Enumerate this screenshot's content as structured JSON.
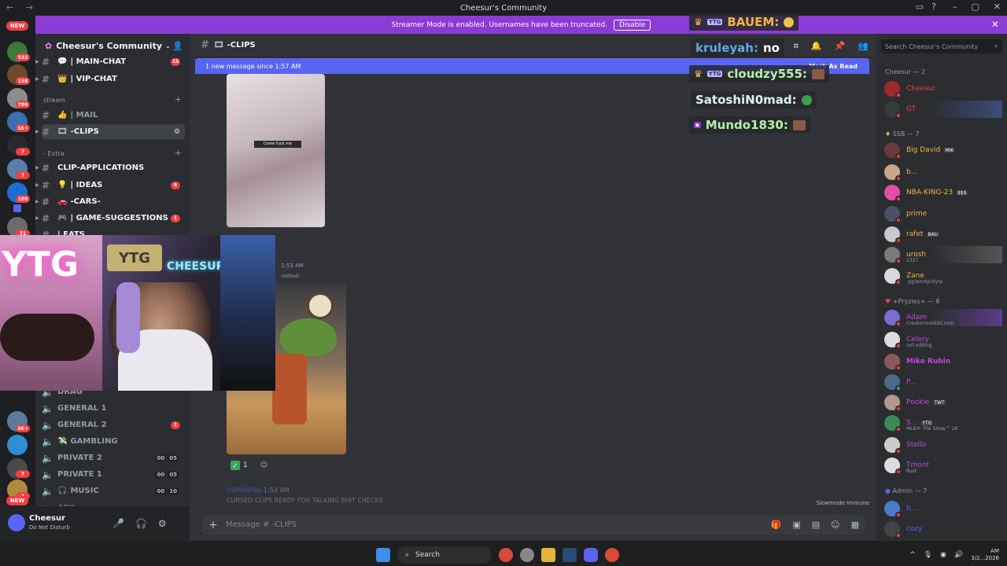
{
  "window": {
    "title": "Cheesur's Community"
  },
  "banner": {
    "text": "Streamer Mode is enabled. Usernames have been truncated.",
    "disable_label": "Disable"
  },
  "rail": {
    "badges": [
      "NEW",
      "532",
      "158",
      "786",
      "1K+",
      "7",
      "7",
      "188",
      "71",
      "3K+",
      "7",
      "2",
      "NEW",
      "759"
    ]
  },
  "server": {
    "name": "Cheesur's Community"
  },
  "channels": [
    {
      "label": "| MAIN-CHAT",
      "badge": "15"
    },
    {
      "label": "| VIP-CHAT"
    },
    {
      "label": "| MAIL"
    },
    {
      "label": "-CLIPS"
    },
    {
      "label": "CLIP-APPLICATIONS"
    },
    {
      "label": "| IDEAS",
      "badge": "6"
    },
    {
      "label": "-CARS-"
    },
    {
      "label": "| GAME-SUGGESTIONS",
      "badge": "1"
    },
    {
      "label": "| EATS"
    }
  ],
  "categories": {
    "stream": "stream",
    "extra": "- Extra"
  },
  "voice": [
    {
      "label": "DRAG"
    },
    {
      "label": "GENERAL 1"
    },
    {
      "label": "GENERAL 2",
      "badge": "1"
    },
    {
      "label": "GAMBLING"
    },
    {
      "label": "PRIVATE 2",
      "c1": "00",
      "c2": "05"
    },
    {
      "label": "PRIVATE 1",
      "c1": "00",
      "c2": "05"
    },
    {
      "label": "MUSIC",
      "c1": "00",
      "c2": "10"
    },
    {
      "label": "AFK"
    }
  ],
  "user": {
    "name": "Cheesur",
    "status": "Do Not Disturb"
  },
  "chat": {
    "channel": "-CLIPS",
    "new_message_bar": "1 new message since 1:57 AM",
    "mark_read": "Mark As Read",
    "time1": "1:53 AM",
    "edited": "(edited)",
    "reaction_count": "1",
    "faded_author": "OSMANPep",
    "faded_time": "1:53 AM",
    "faded_text": "CURSED CLIPS READY FOR TALKING SHIT CHECKS",
    "slowmode": "Slowmode Immune",
    "input_placeholder": "Message #  -CLIPS",
    "image1_caption": "Come fuck me"
  },
  "stream_chat": [
    {
      "name": "BAUEM:",
      "msg": "",
      "color": "#f6b63d"
    },
    {
      "name": "kruleyah:",
      "msg": "no",
      "color": "#5ea9e5"
    },
    {
      "name": "cloudzy555:",
      "msg": "",
      "color": "#b2f3a3"
    },
    {
      "name": "SatoshiN0mad:",
      "msg": "",
      "color": "#d8f2f5"
    },
    {
      "name": "Mundo1830:",
      "msg": "",
      "color": "#b2f3a3"
    }
  ],
  "webcam": {
    "sign": "YTG",
    "neon": "YTG",
    "neon2": "CHEESUR"
  },
  "members": {
    "search_placeholder": "Search Cheesur's Community",
    "groups": [
      {
        "title": "Cheesur — 2"
      },
      {
        "title": "SSB — 7"
      },
      {
        "title": "+Pryzies+ — 8"
      },
      {
        "title": "Admin — 7"
      }
    ],
    "list": [
      {
        "name": "Cheesur",
        "color": "#f23f43"
      },
      {
        "name": "GT",
        "color": "#f23f43"
      },
      {
        "name": "Big David",
        "color": "#f6b63d",
        "tag": "MIK"
      },
      {
        "name": "b...",
        "color": "#f6b63d"
      },
      {
        "name": "NBA-KING-23",
        "color": "#f6b63d",
        "tag": "$$$"
      },
      {
        "name": "prime",
        "color": "#f6b63d"
      },
      {
        "name": "rafet",
        "color": "#f6b63d",
        "tag": "BAU"
      },
      {
        "name": "urosh",
        "color": "#f6b63d",
        "sub": "1337"
      },
      {
        "name": "Zane",
        "color": "#f6b63d",
        "sub": ".gg/windycityrp"
      },
      {
        "name": "Adam",
        "color": "#c048d9",
        "sub": "Creatortoolslist.com"
      },
      {
        "name": "Celery",
        "color": "#c048d9",
        "sub": "not editing"
      },
      {
        "name": "Mike Rubin",
        "color": "#c048d9"
      },
      {
        "name": "P...",
        "color": "#c048d9"
      },
      {
        "name": "Pookie",
        "color": "#c048d9",
        "tag": "TWT"
      },
      {
        "name": "S...",
        "color": "#c048d9",
        "tag": "YTG",
        "sub": "MLB® The Show™ 26"
      },
      {
        "name": "Stello",
        "color": "#c048d9"
      },
      {
        "name": "Tmont",
        "color": "#c048d9",
        "sub": "Rust"
      },
      {
        "name": "b...",
        "color": "#5865f2"
      },
      {
        "name": "cozy",
        "color": "#5865f2"
      }
    ]
  },
  "taskbar": {
    "search": "Search",
    "time": "AM",
    "date": "3/2...2026"
  }
}
